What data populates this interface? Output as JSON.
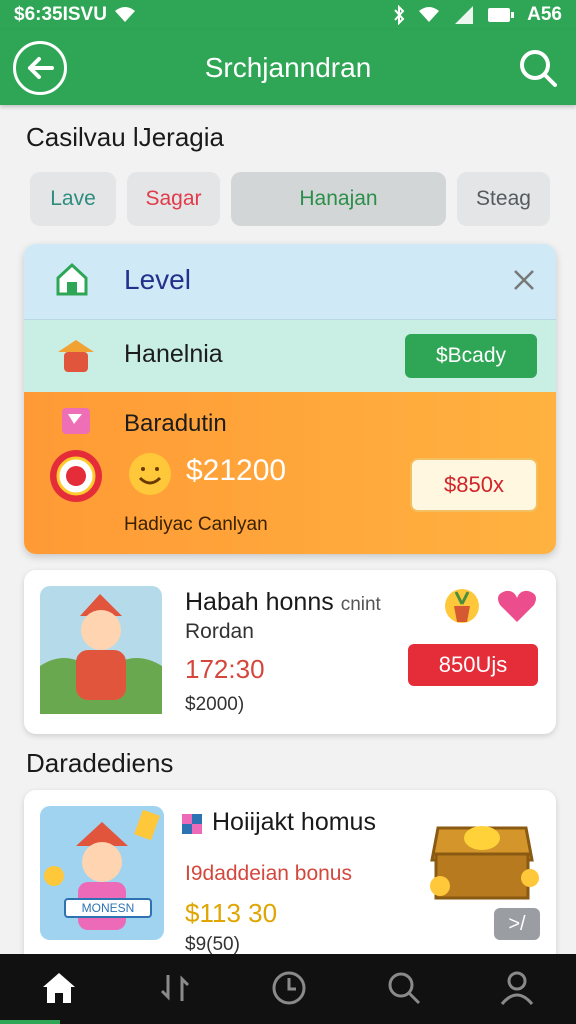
{
  "status": {
    "left_text": "$6:35ISVU",
    "right_text": "A56"
  },
  "app_bar": {
    "title": "Srchjanndran"
  },
  "section1": {
    "title": "Casilvau lJeragia"
  },
  "chips": [
    {
      "label": "Lave",
      "color": "#2f8d80"
    },
    {
      "label": "Sagar",
      "color": "#e23a4a"
    },
    {
      "label": "Hanajan",
      "color": "#2b8f4a"
    },
    {
      "label": "Steag",
      "color": "#555b61"
    }
  ],
  "level_row": {
    "title": "Level"
  },
  "hanel_row": {
    "title": "Hanelnia",
    "button": "$Bcady"
  },
  "bara_row": {
    "title": "Baradutin",
    "amount": "$21200",
    "subtitle": "Hadiyac Canlyan",
    "button": "$850x"
  },
  "card1": {
    "title": "Habah honns",
    "title_suffix": "cnint",
    "subtitle": "Rordan",
    "price": "172:30",
    "old_price": "$2000)",
    "button": "850Ujs"
  },
  "section2": {
    "title": "Daradediens"
  },
  "card2": {
    "title": "Hoiijakt homus",
    "subtitle": "I9daddeian bonus",
    "price": "$113 30",
    "old_price": "$9(50)",
    "badge": "MONESN",
    "arrow_button": ">/"
  },
  "colors": {
    "primary": "#2ea655",
    "accent_red": "#e52d3a",
    "orange": "#ff9a35"
  },
  "icons": [
    "back-arrow-icon",
    "search-icon",
    "home-icon",
    "bluetooth-icon",
    "wifi-icon",
    "signal-icon",
    "battery-icon",
    "close-icon"
  ]
}
